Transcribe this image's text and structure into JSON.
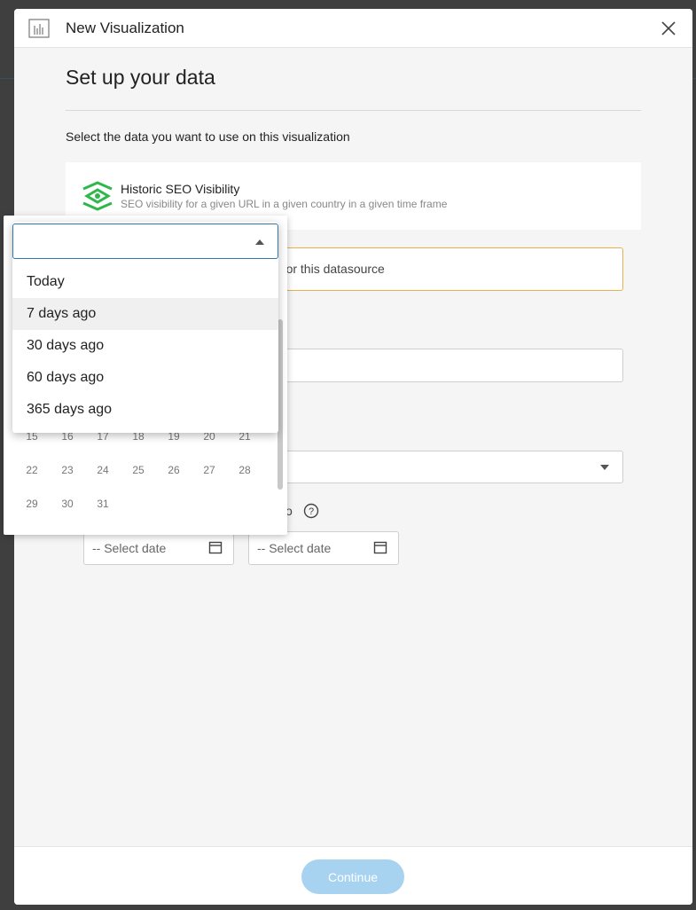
{
  "modal": {
    "title": "New Visualization",
    "close_icon": "close-icon"
  },
  "setup": {
    "heading": "Set up your data",
    "instructions": "Select the data you want to use on this visualization"
  },
  "datasource": {
    "name": "Historic SEO Visibility",
    "description": "SEO visibility for a given URL in a given country in a given time frame",
    "brand_color": "#2eb84b"
  },
  "notice": {
    "text": "d for this datasource",
    "border_color": "#e7b24a"
  },
  "date_range": {
    "to_label": "o",
    "from_placeholder": "-- Select date",
    "to_placeholder": "-- Select date"
  },
  "calendar": {
    "rows": [
      [
        "15",
        "16",
        "17",
        "18",
        "19",
        "20",
        "21"
      ],
      [
        "22",
        "23",
        "24",
        "25",
        "26",
        "27",
        "28"
      ],
      [
        "29",
        "30",
        "31"
      ]
    ]
  },
  "dropdown": {
    "options": [
      "Today",
      "7 days ago",
      "30 days ago",
      "60 days ago",
      "365 days ago"
    ],
    "highlighted": "7 days ago",
    "accent_color": "#2f78b5"
  },
  "footer": {
    "continue_label": "Continue",
    "button_color": "#a8d3f0"
  }
}
